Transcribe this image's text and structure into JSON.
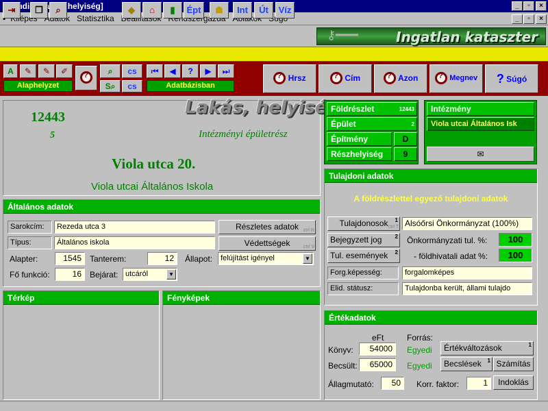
{
  "window": {
    "title": "mdi - [Lakás, helyiség]"
  },
  "menu": [
    "Kilépés",
    "Adatok",
    "Statisztika",
    "Beállítások",
    "Rendszergazda",
    "Ablakok",
    "Súgó"
  ],
  "toolbar": {
    "ept": "Épt",
    "int": "Int",
    "ut": "Út",
    "viz": "Víz"
  },
  "logo": {
    "title": "Ingatlan kataszter"
  },
  "nav": {
    "mode_letter": "A",
    "alaphelyzet": "Alaphelyzet",
    "adatbazisban": "Adatbázisban",
    "help_q": "?",
    "hrsz": "Hrsz",
    "cim": "Cím",
    "azon": "Azon",
    "megnev": "Megnev",
    "sugo": "Súgó"
  },
  "record": {
    "id": "12443",
    "sub": "5",
    "type_title": "Lakás, helyiség",
    "type_subtitle": "Intézményi épületrész",
    "address": "Viola utca  20.",
    "name": "Viola utcai Általános Iskola"
  },
  "hierarchy": {
    "foldreszlet": {
      "label": "Földrészlet",
      "value": "12443"
    },
    "epulet": {
      "label": "Épület",
      "value": "2"
    },
    "epitmeny": {
      "label": "Építmény",
      "value": "D"
    },
    "reszhelyiseg": {
      "label": "Részhelyiség",
      "value": "9"
    },
    "intezmeny_label": "Intézmény",
    "intezmeny_value": "Viola utcai Általános Isk"
  },
  "general": {
    "header": "Általános adatok",
    "sarokcim_label": "Sarokcím:",
    "sarokcim": "Rezeda utca 3",
    "tipus_label": "Típus:",
    "tipus": "Általános iskola",
    "reszletes_btn": "Részletes adatok",
    "reszletes_short": "ctrl R",
    "vedettsegek_btn": "Védettségek",
    "vedettsegek_short": "ctrl V",
    "alapter_label": "Alapter:",
    "alapter": "1545",
    "tanterem_label": "Tanterem:",
    "tanterem": "12",
    "allapot_label": "Állapot:",
    "allapot": "felújítást igényel",
    "fofunkcio_label": "Fő funkció:",
    "fofunkcio": "16",
    "bejarat_label": "Bejárat:",
    "bejarat": "utcáról"
  },
  "panels": {
    "terkep": "Térkép",
    "fenykepek": "Fényképek"
  },
  "ownership": {
    "header": "Tulajdoni adatok",
    "subtitle": "A földrészlettel egyező tulajdoni adatok",
    "tulajdonosok_btn": "Tulajdonosok",
    "tulajdonosok_count": "1",
    "tulajdonosok_short": "ctrl T",
    "owner": "Alsóőrsi Önkormányzat (100%)",
    "bejegyzett_btn": "Bejegyzett jog",
    "bejegyzett_count": "2",
    "onk_label": "Önkormányzati tul. %:",
    "onk_value": "100",
    "esemenyek_btn": "Tul. események",
    "esemenyek_count": "2",
    "fold_label": "- földhivatali adat %:",
    "fold_value": "100",
    "forg_label": "Forg.képesség:",
    "forg_value": "forgalomképes",
    "elid_label": "Elid. státusz:",
    "elid_value": "Tulajdonba került, állami tulajdo"
  },
  "values": {
    "header": "Értékadatok",
    "eft": "eFt",
    "forras": "Forrás:",
    "konyv_label": "Könyv:",
    "konyv": "54000",
    "konyv_src": "Egyedi",
    "becsult_label": "Becsült:",
    "becsult": "65000",
    "becsult_src": "Egyedi",
    "ertekvaltozasok_btn": "Értékváltozások",
    "ertekvaltozasok_count": "1",
    "becslesek_btn": "Becslések",
    "becslesek_count": "1",
    "szamitas_btn": "Számítás",
    "allagmutato_label": "Állagmutató:",
    "allagmutato": "50",
    "korr_label": "Korr. faktor:",
    "korr": "1",
    "indoklas_btn": "Indoklás"
  }
}
